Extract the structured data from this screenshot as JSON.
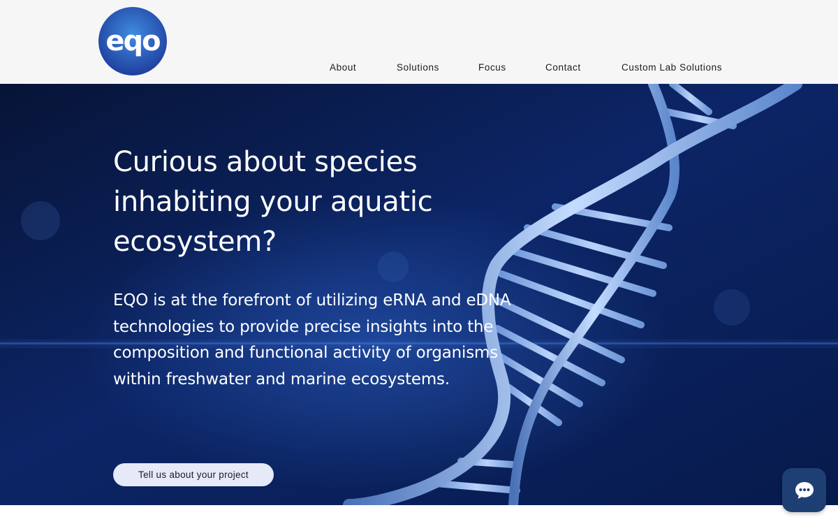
{
  "brand": {
    "logo_text": "eqo",
    "logo_colors": {
      "outer": "#1f3f9e",
      "inner": "#3f8ce0"
    }
  },
  "nav": {
    "items": [
      {
        "label": "About"
      },
      {
        "label": "Solutions"
      },
      {
        "label": "Focus"
      },
      {
        "label": "Contact"
      },
      {
        "label": "Custom Lab Solutions"
      }
    ]
  },
  "hero": {
    "headline": "Curious about species inhabiting your aquatic ecosystem?",
    "description": "EQO is at the forefront of utilizing eRNA and eDNA technologies to provide precise insights into the composition and functional activity of organisms within freshwater and marine ecosystems.",
    "cta_label": "Tell us about your project",
    "background_color": "#0a1c4a",
    "helix_color": "#8fb6ee"
  },
  "chat": {
    "icon": "chat-bubble-icon",
    "color": "#1d3f74"
  }
}
